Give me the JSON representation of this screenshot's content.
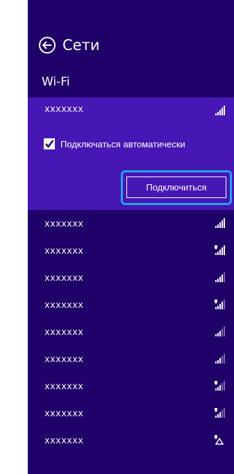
{
  "header": {
    "title": "Сети",
    "back_icon": "back-arrow-icon"
  },
  "section": {
    "label": "Wi-Fi"
  },
  "expanded_network": {
    "name": "xxxxxxx",
    "auto_connect_label": "Подключаться автоматически",
    "auto_connect_checked": true,
    "connect_button_label": "Подключиться",
    "signal_level": 4,
    "secured": false
  },
  "networks": [
    {
      "name": "xxxxxxx",
      "signal_level": 4,
      "secured": false,
      "shared": false
    },
    {
      "name": "xxxxxxx",
      "signal_level": 4,
      "secured": true,
      "shared": false
    },
    {
      "name": "xxxxxxx",
      "signal_level": 3,
      "secured": false,
      "shared": false
    },
    {
      "name": "xxxxxxx",
      "signal_level": 3,
      "secured": true,
      "shared": false
    },
    {
      "name": "xxxxxxx",
      "signal_level": 2,
      "secured": false,
      "shared": false
    },
    {
      "name": "xxxxxxx",
      "signal_level": 2,
      "secured": false,
      "shared": false
    },
    {
      "name": "xxxxxxx",
      "signal_level": 2,
      "secured": true,
      "shared": false
    },
    {
      "name": "xxxxxxx",
      "signal_level": 2,
      "secured": true,
      "shared": false
    },
    {
      "name": "xxxxxxx",
      "signal_level": 0,
      "secured": true,
      "shared": true
    }
  ],
  "colors": {
    "panel_bg": "#1f0068",
    "selected_bg": "#4617b4",
    "highlight": "#21a6e6",
    "text": "#ffffff"
  }
}
